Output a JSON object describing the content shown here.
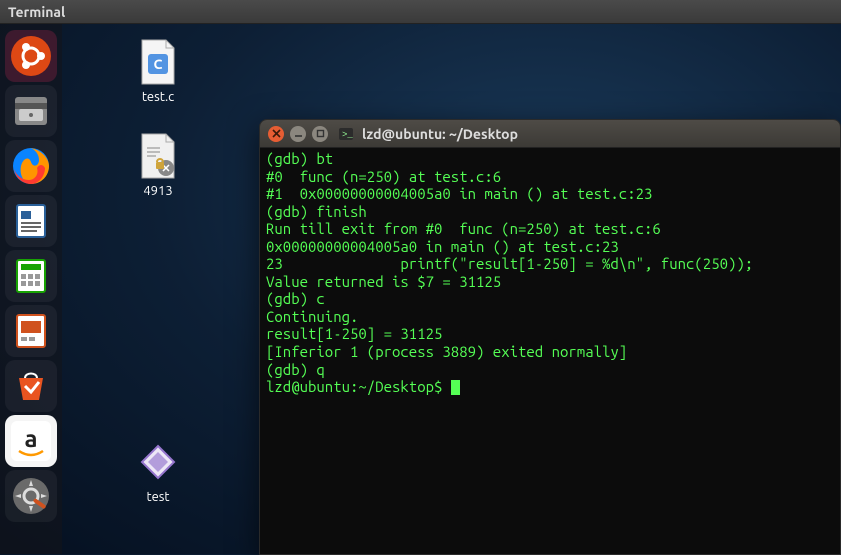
{
  "menubar": {
    "active_app": "Terminal"
  },
  "launcher": {
    "items": [
      {
        "name": "ubuntu-dash"
      },
      {
        "name": "files"
      },
      {
        "name": "firefox"
      },
      {
        "name": "writer"
      },
      {
        "name": "calc"
      },
      {
        "name": "impress"
      },
      {
        "name": "software-center"
      },
      {
        "name": "amazon"
      },
      {
        "name": "settings"
      }
    ]
  },
  "desktop": {
    "icons": [
      {
        "label": "test.c",
        "kind": "c-source"
      },
      {
        "label": "4913",
        "kind": "locked-file"
      },
      {
        "label": "test",
        "kind": "executable"
      }
    ]
  },
  "terminal": {
    "title": "lzd@ubuntu: ~/Desktop",
    "lines": [
      "(gdb) bt",
      "#0  func (n=250) at test.c:6",
      "#1  0x00000000004005a0 in main () at test.c:23",
      "(gdb) finish",
      "Run till exit from #0  func (n=250) at test.c:6",
      "0x00000000004005a0 in main () at test.c:23",
      "23              printf(\"result[1-250] = %d\\n\", func(250));",
      "Value returned is $7 = 31125",
      "(gdb) c",
      "Continuing.",
      "result[1-250] = 31125",
      "[Inferior 1 (process 3889) exited normally]",
      "(gdb) q",
      "lzd@ubuntu:~/Desktop$ "
    ]
  }
}
